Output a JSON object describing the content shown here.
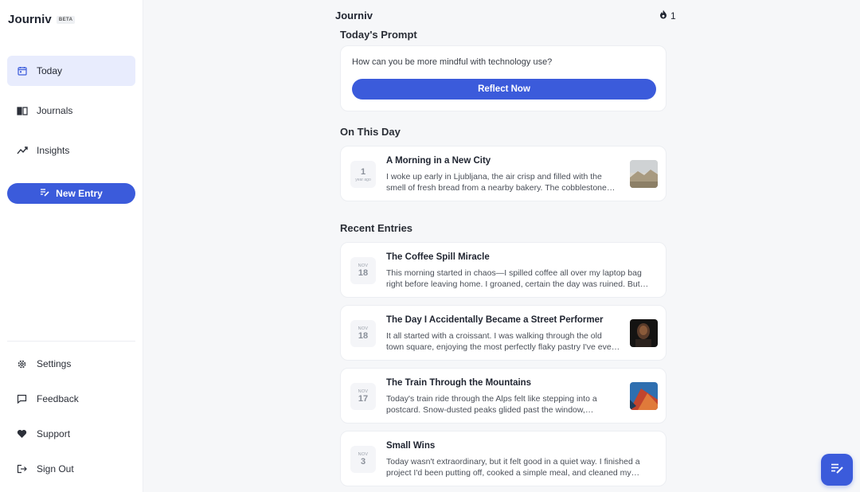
{
  "app": {
    "name": "Journiv",
    "badge": "BETA"
  },
  "sidebar": {
    "items": [
      {
        "label": "Today",
        "icon": "calendar-icon",
        "active": true
      },
      {
        "label": "Journals",
        "icon": "book-icon",
        "active": false
      },
      {
        "label": "Insights",
        "icon": "trend-icon",
        "active": false
      }
    ],
    "new_entry_label": "New Entry",
    "bottom_items": [
      {
        "label": "Settings",
        "icon": "gear-icon"
      },
      {
        "label": "Feedback",
        "icon": "chat-icon"
      },
      {
        "label": "Support",
        "icon": "heart-icon"
      },
      {
        "label": "Sign Out",
        "icon": "signout-icon"
      }
    ]
  },
  "header": {
    "title": "Journiv",
    "streak_count": "1",
    "streak_icon": "flame-icon"
  },
  "prompt": {
    "section_title": "Today's Prompt",
    "question": "How can you be more mindful with technology use?",
    "button_label": "Reflect Now"
  },
  "on_this_day": {
    "section_title": "On This Day",
    "entry": {
      "date_num": "1",
      "date_sub": "year ago",
      "title": "A Morning in a New City",
      "snippet": "I woke up early in Ljubljana, the air crisp and filled with the smell of fresh bread from a nearby bakery. The cobblestone streets were quiet…"
    }
  },
  "recent": {
    "section_title": "Recent Entries",
    "entries": [
      {
        "month": "NOV",
        "day": "18",
        "title": "The Coffee Spill Miracle",
        "snippet": "This morning started in chaos—I spilled coffee all over my laptop bag right before leaving home. I groaned, certain the day was ruined. But…",
        "has_thumb": false
      },
      {
        "month": "NOV",
        "day": "18",
        "title": "The Day I Accidentally Became a Street Performer",
        "snippet": "It all started with a croissant. I was walking through the old town square, enjoying the most perfectly flaky pastry I've ever had…",
        "has_thumb": true
      },
      {
        "month": "NOV",
        "day": "17",
        "title": "The Train Through the Mountains",
        "snippet": "Today's train ride through the Alps felt like stepping into a postcard. Snow-dusted peaks glided past the window, interrupted only…",
        "has_thumb": true
      },
      {
        "month": "NOV",
        "day": "3",
        "title": "Small Wins",
        "snippet": "Today wasn't extraordinary, but it felt good in a quiet way. I finished a project I'd been putting off, cooked a simple meal, and cleaned my desk…",
        "has_thumb": false
      }
    ]
  },
  "colors": {
    "accent": "#3b5bdb",
    "active_bg": "#e8ecfd",
    "page_bg": "#f6f7f9"
  }
}
